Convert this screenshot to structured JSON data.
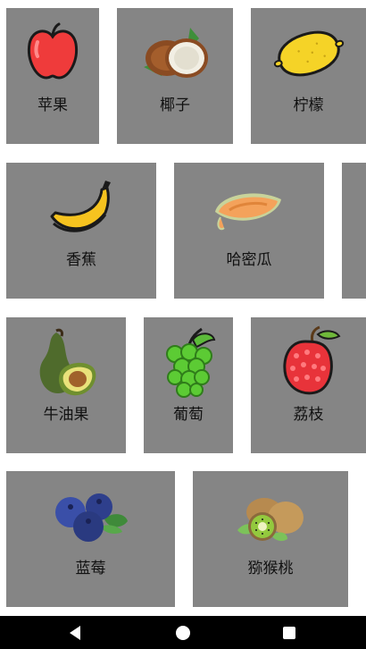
{
  "fruits": [
    {
      "label": "苹果",
      "icon": "apple-icon"
    },
    {
      "label": "椰子",
      "icon": "coconut-icon"
    },
    {
      "label": "柠檬",
      "icon": "lemon-icon"
    },
    {
      "label": "香蕉",
      "icon": "banana-icon"
    },
    {
      "label": "哈密瓜",
      "icon": "cantaloupe-icon"
    },
    {
      "label": "牛油果",
      "icon": "avocado-icon"
    },
    {
      "label": "葡萄",
      "icon": "grapes-icon"
    },
    {
      "label": "荔枝",
      "icon": "lychee-icon"
    },
    {
      "label": "蓝莓",
      "icon": "blueberry-icon"
    },
    {
      "label": "猕猴桃",
      "icon": "kiwi-icon"
    }
  ],
  "colors": {
    "card_background": "#858585",
    "navbar": "#000000"
  },
  "navbar": {
    "back": "back-icon",
    "home": "home-icon",
    "recents": "recents-icon"
  }
}
